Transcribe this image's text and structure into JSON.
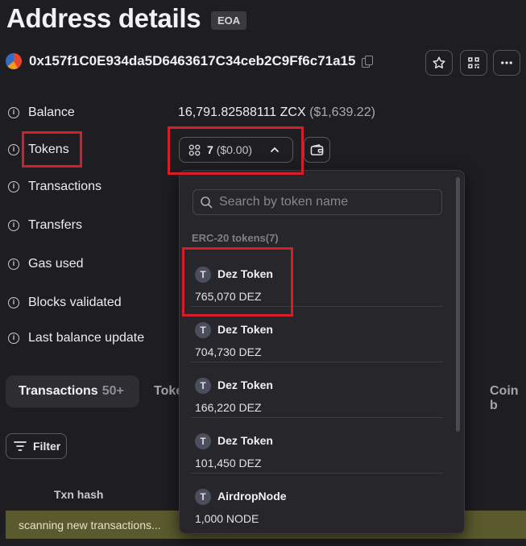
{
  "header": {
    "title": "Address details",
    "badge": "EOA"
  },
  "address": {
    "hash": "0x157f1C0E934da5D6463617C34ceb2C9Ff6c71a15"
  },
  "details": {
    "balance_label": "Balance",
    "balance_value": "16,791.82588111 ZCX",
    "balance_usd": "($1,639.22)",
    "tokens_label": "Tokens",
    "tokens_count": "7",
    "tokens_usd": "($0.00)",
    "transactions_label": "Transactions",
    "transfers_label": "Transfers",
    "gas_used_label": "Gas used",
    "blocks_validated_label": "Blocks validated",
    "last_balance_update_label": "Last balance update"
  },
  "tabs": {
    "active_label": "Transactions",
    "active_count": "50+",
    "partial_next": "Toke",
    "partial_right": "Coin b"
  },
  "filter": {
    "label": "Filter"
  },
  "table": {
    "txn_hash_header": "Txn hash"
  },
  "status": {
    "scanning": "scanning new transactions..."
  },
  "token_dropdown": {
    "search_placeholder": "Search by token name",
    "group_heading": "ERC-20 tokens(7)",
    "items": [
      {
        "logo": "T",
        "name": "Dez Token",
        "balance": "765,070 DEZ"
      },
      {
        "logo": "T",
        "name": "Dez Token",
        "balance": "704,730 DEZ"
      },
      {
        "logo": "T",
        "name": "Dez Token",
        "balance": "166,220 DEZ"
      },
      {
        "logo": "T",
        "name": "Dez Token",
        "balance": "101,450 DEZ"
      },
      {
        "logo": "T",
        "name": "AirdropNode",
        "balance": "1,000 NODE"
      }
    ]
  },
  "colors": {
    "background": "#1e1e22",
    "dropdown_bg": "#27272b",
    "highlight_red": "#d41f2a",
    "scan_bar": "#5b5a2e"
  },
  "icons": [
    "copy-icon",
    "star-icon",
    "qr-code-icon",
    "more-icon",
    "info-icon",
    "token-grid-icon",
    "chevron-up-icon",
    "wallet-icon",
    "filter-icon",
    "search-icon"
  ]
}
